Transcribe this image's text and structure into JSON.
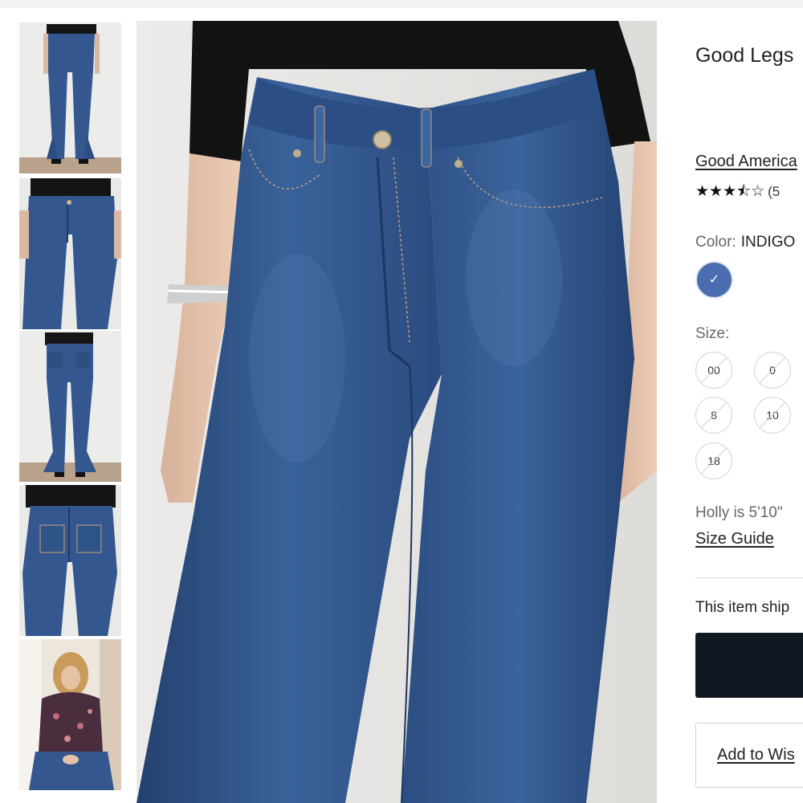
{
  "product": {
    "title": "Good Legs",
    "brand": "Good America",
    "rating_stars": "★★★⯪☆",
    "rating_value": 3.5,
    "rating_count": "(5"
  },
  "color": {
    "label": "Color:",
    "value": "INDIGO",
    "swatch_hex": "#4a6db0",
    "check_icon": "✓"
  },
  "size": {
    "label": "Size:",
    "options": [
      "00",
      "0",
      "8",
      "10",
      "18"
    ]
  },
  "model_info": "Holly is 5'10\"",
  "size_guide": "Size Guide",
  "shipping_note": "This item ship",
  "wishlist_label": "Add to Wis",
  "thumbnails": [
    "thumb-front-full",
    "thumb-front-closeup",
    "thumb-back-full",
    "thumb-back-closeup",
    "thumb-lifestyle"
  ],
  "colors": {
    "denim": "#2f5488",
    "denim_dark": "#1f3c66",
    "button_dark": "#121821"
  }
}
